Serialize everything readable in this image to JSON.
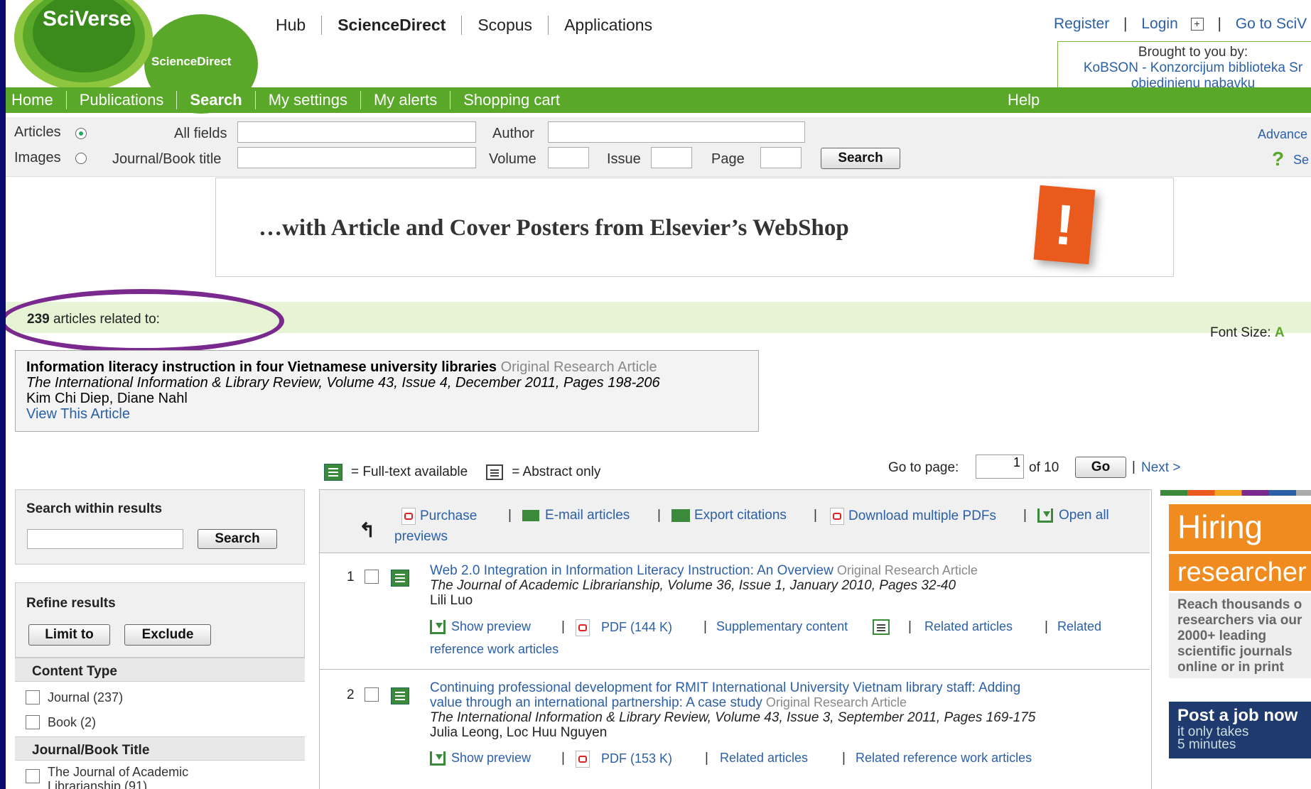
{
  "header": {
    "logo": "SciVerse",
    "logo_sub": "ScienceDirect",
    "topnav": [
      "Hub",
      "ScienceDirect",
      "Scopus",
      "Applications"
    ],
    "register": "Register",
    "login": "Login",
    "goto": "Go to SciV",
    "brought_label": "Brought to you by:",
    "brought_line1": "KoBSON - Konzorcijum biblioteka Sr",
    "brought_line2": "objedinjenu nabavku"
  },
  "mainnav": [
    "Home",
    "Publications",
    "Search",
    "My settings",
    "My alerts",
    "Shopping cart"
  ],
  "help": "Help",
  "search": {
    "articles": "Articles",
    "images": "Images",
    "all_fields": "All fields",
    "author": "Author",
    "journal_title": "Journal/Book title",
    "volume": "Volume",
    "issue": "Issue",
    "page": "Page",
    "button": "Search",
    "advanced": "Advance",
    "search_tips": "Se"
  },
  "banner": {
    "text": "…with Article and Cover Posters from Elsevier’s WebShop",
    "mark": "!"
  },
  "results_header": {
    "count": "239",
    "count_text": " articles related to:",
    "font_size": "Font Size:",
    "font_a": "A"
  },
  "related_article": {
    "title": "Information literacy instruction in four Vietnamese university libraries",
    "type": " Original Research Article",
    "source": "The International Information & Library Review, Volume 43, Issue 4, December 2011, Pages 198-206",
    "authors": "Kim Chi Diep, Diane Nahl",
    "view": "View This Article"
  },
  "legend": {
    "full_text": "= Full-text available",
    "abstract": "= Abstract only"
  },
  "pagination": {
    "goto": "Go to page:",
    "current": "1",
    "of": "of 10",
    "go": "Go",
    "sep": "|",
    "next": "Next >"
  },
  "sidebar": {
    "within": "Search within results",
    "search_btn": "Search",
    "refine": "Refine results",
    "limit": "Limit to",
    "exclude": "Exclude",
    "content_type": "Content Type",
    "journal": "Journal (237)",
    "book": "Book (2)",
    "journal_title": "Journal/Book Title",
    "jt_item1": "The Journal of Academic",
    "jt_item1b": "Librarianship (91)"
  },
  "toolbar": {
    "purchase": "Purchase",
    "email": "E-mail articles",
    "export": "Export citations",
    "download": "Download multiple PDFs",
    "open": "Open all",
    "previews": "previews"
  },
  "results": [
    {
      "num": "1",
      "title": "Web 2.0 Integration in Information Literacy Instruction: An Overview",
      "type": " Original Research Article",
      "source": "The Journal of Academic Librarianship, Volume 36, Issue 1, January 2010, Pages 32-40",
      "authors": "Lili Luo",
      "preview": "Show preview",
      "pdf": "PDF (144 K)",
      "supp": "Supplementary content",
      "related": "Related articles",
      "related2": "Related",
      "related3": "reference work articles"
    },
    {
      "num": "2",
      "title1": "Continuing professional development for RMIT International University Vietnam library staff: Adding",
      "title2": "value through an international partnership: A case study",
      "type": " Original Research Article",
      "source": "The International Information & Library Review, Volume 43, Issue 3, September 2011, Pages 169-175",
      "authors": "Julia Leong, Loc Huu Nguyen",
      "preview": "Show preview",
      "pdf": "PDF (153 K)",
      "related": "Related articles",
      "related2": "Related reference work articles"
    }
  ],
  "ad": {
    "hiring": "Hiring",
    "researchers": "researcher",
    "body1": "Reach thousands o",
    "body2": "researchers via our",
    "body3": "2000+ leading",
    "body4": "scientific journals",
    "body5": "online or in print",
    "post": "Post a job now",
    "post2": "it only takes",
    "post3": "5 minutes"
  }
}
